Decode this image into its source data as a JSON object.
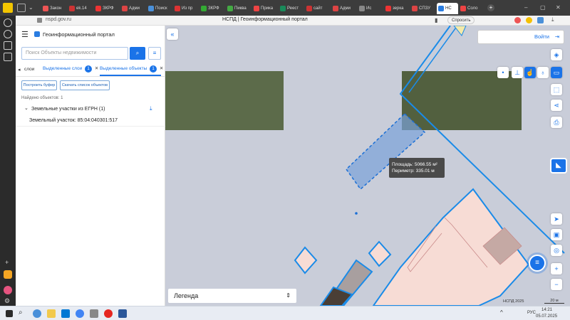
{
  "browser": {
    "tabs": [
      "Закон",
      "ek.14",
      "ЗКРФ",
      "Адми",
      "Поиск",
      "Из пр",
      "ЗКРФ",
      "Пиква",
      "Прика",
      "Реест",
      "сайт",
      "Адми",
      "Ис",
      "зерка",
      "СПЗУ",
      "НС",
      "Соло"
    ],
    "address": "nspd.gov.ru",
    "title": "НСПД | Геоинформационный портал",
    "ask_label": "Спросить"
  },
  "app": {
    "portal_title": "Геоинформационный портал",
    "login_label": "Войти"
  },
  "panel": {
    "search_placeholder": "Поиск Объекты недвижимости",
    "tabs": [
      {
        "label": "слои"
      },
      {
        "label": "Выделенные слои",
        "badge": "1"
      },
      {
        "label": "Выделенные объекты",
        "badge": "1"
      }
    ],
    "build_buffer_label": "Построить буфер",
    "download_list_label": "Скачать список объектов",
    "found_label": "Найдено объектов: 1",
    "group_label": "Земельные участки из ЕГРН (1)",
    "item_label": "Земельный участок: 85:04:040301:517"
  },
  "map": {
    "measure_area": "Площадь: 5066.55 м²",
    "measure_perimeter": "Периметр: 335.01 м",
    "legend_label": "Легенда",
    "attribution": "НСПД 2025",
    "scale": "20 м"
  },
  "taskbar": {
    "time": "14:21",
    "date": "05.07.2025",
    "lang": "РУС"
  }
}
